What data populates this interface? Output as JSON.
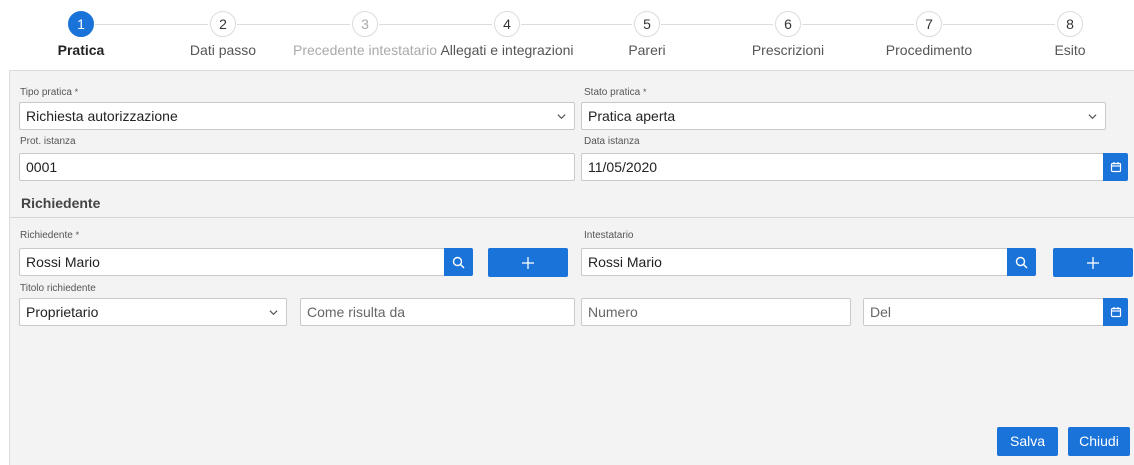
{
  "steps": [
    {
      "number": "1",
      "label": "Pratica",
      "state": "active"
    },
    {
      "number": "2",
      "label": "Dati passo",
      "state": "normal"
    },
    {
      "number": "3",
      "label": "Precedente intestatario",
      "state": "disabled"
    },
    {
      "number": "4",
      "label": "Allegati e integrazioni",
      "state": "normal"
    },
    {
      "number": "5",
      "label": "Pareri",
      "state": "normal"
    },
    {
      "number": "6",
      "label": "Prescrizioni",
      "state": "normal"
    },
    {
      "number": "7",
      "label": "Procedimento",
      "state": "normal"
    },
    {
      "number": "8",
      "label": "Esito",
      "state": "normal"
    }
  ],
  "form": {
    "required_mark": "*",
    "tipo_pratica": {
      "label": "Tipo pratica",
      "value": "Richiesta autorizzazione"
    },
    "stato_pratica": {
      "label": "Stato pratica",
      "value": "Pratica aperta"
    },
    "prot_istanza": {
      "label": "Prot. istanza",
      "value": "0001"
    },
    "data_istanza": {
      "label": "Data istanza",
      "value": "11/05/2020"
    },
    "section_richiedente": "Richiedente",
    "richiedente": {
      "label": "Richiedente",
      "value": "Rossi Mario"
    },
    "intestatario": {
      "label": "Intestatario",
      "value": "Rossi Mario"
    },
    "titolo_richiedente": {
      "label": "Titolo richiedente",
      "value": "Proprietario"
    },
    "come_risulta_da": {
      "placeholder": "Come risulta da"
    },
    "numero": {
      "placeholder": "Numero"
    },
    "del": {
      "placeholder": "Del"
    }
  },
  "actions": {
    "save": "Salva",
    "close": "Chiudi"
  },
  "colors": {
    "accent": "#1a73d8",
    "panel_bg": "#f3f3f3"
  }
}
